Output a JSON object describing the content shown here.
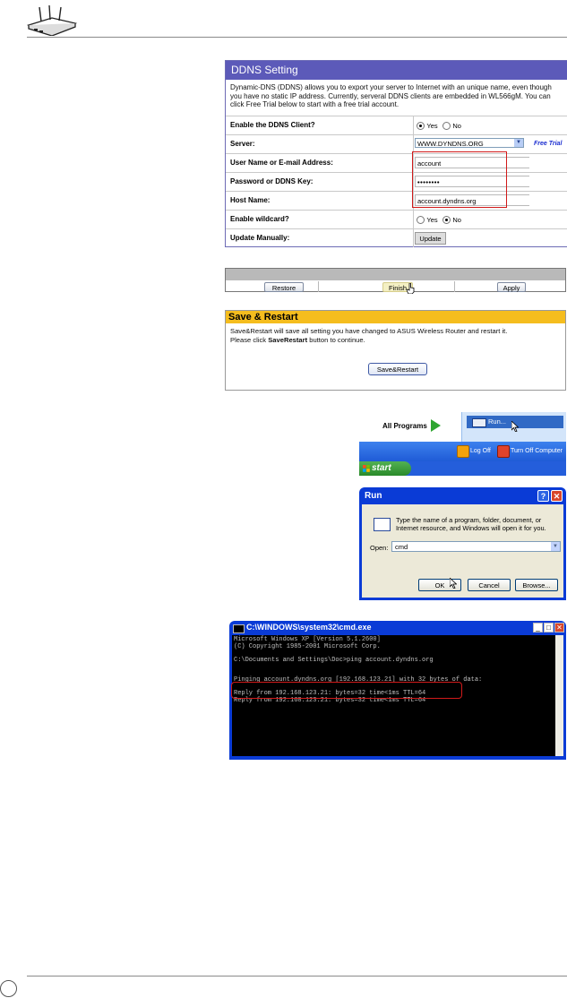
{
  "ddns": {
    "title": "DDNS Setting",
    "description": "Dynamic-DNS (DDNS) allows you to export your server to Internet with an unique name, even though you have no static IP address. Currently, serveral DDNS clients are embedded in WL566gM. You can click Free Trial below to start with a free trial account.",
    "rows": [
      {
        "label": "Enable the DDNS Client?"
      },
      {
        "label": "Server:"
      },
      {
        "label": "User Name or E-mail Address:"
      },
      {
        "label": "Password or DDNS Key:"
      },
      {
        "label": "Host Name:"
      },
      {
        "label": "Enable wildcard?"
      },
      {
        "label": "Update Manually:"
      }
    ],
    "enable_yes": "Yes",
    "enable_no": "No",
    "enable_selected": "Yes",
    "server_value": "WWW.DYNDNS.ORG",
    "free_trial": "Free Trial",
    "username_value": "account",
    "password_value": "••••••••",
    "hostname_value": "account.dyndns.org",
    "wildcard_yes": "Yes",
    "wildcard_no": "No",
    "wildcard_selected": "No",
    "update_button": "Update"
  },
  "button_bar": {
    "restore": "Restore",
    "finish": "Finish",
    "apply": "Apply"
  },
  "save_restart": {
    "title": "Save & Restart",
    "line1": "Save&Restart will save all setting you have changed to ASUS Wireless Router and restart it.",
    "line2_prefix": "Please click ",
    "line2_bold": "SaveRestart",
    "line2_suffix": " button to continue.",
    "button": "Save&Restart"
  },
  "start_menu": {
    "all_programs": "All Programs",
    "run_item": "Run...",
    "log_off": "Log Off",
    "turn_off": "Turn Off Computer",
    "start": "start"
  },
  "run_dialog": {
    "title": "Run",
    "message": "Type the name of a program, folder, document, or Internet resource, and Windows will open it for you.",
    "open_label": "Open:",
    "open_value": "cmd",
    "ok": "OK",
    "cancel": "Cancel",
    "browse": "Browse..."
  },
  "cmd": {
    "title": "C:\\WINDOWS\\system32\\cmd.exe",
    "lines": [
      "Microsoft Windows XP [Version 5.1.2600]",
      "(C) Copyright 1985-2001 Microsoft Corp.",
      "",
      "C:\\Documents and Settings\\Doc>ping account.dyndns.org",
      "",
      "",
      "Pinging account.dyndns.org [192.168.123.21] with 32 bytes of data:",
      "",
      "Reply from 192.168.123.21: bytes=32 time<1ms TTL=64",
      "Reply from 192.168.123.21: bytes=32 time<1ms TTL=64"
    ]
  },
  "colors": {
    "ddns_header": "#5c5ab9",
    "save_header": "#f5bd1e",
    "highlight_red": "#d11a1a",
    "xp_blue": "#0a3bd6"
  }
}
